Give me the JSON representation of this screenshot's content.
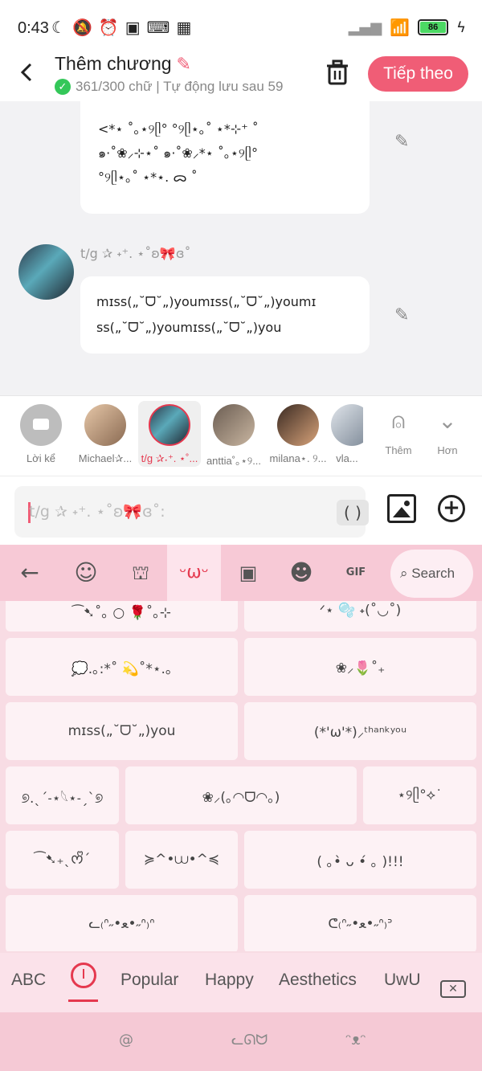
{
  "status_bar": {
    "time": "0:43",
    "battery": "86"
  },
  "header": {
    "title": "Thêm chương",
    "subtitle": "361/300 chữ | Tự động lưu sau 59",
    "next_label": "Tiếp theo"
  },
  "chat": {
    "bubble1_lines": [
      "<*⋆ ˚｡⋆୨ᥫ°   °୨ᥫ⋆｡˚ ⋆*⊹⁺ ˚",
      "๑·˚❀⸝⊹⋆˚ ๑·˚❀⸝*⋆ ˚｡⋆୨ᥫ°",
      "°୨ᥫ⋆｡˚ ⋆*⋆. ᯅ ˚"
    ],
    "sender_name": "t/g ✰ ˖⁺. ⋆˚ʚ🎀ɞ˚",
    "bubble2_lines": [
      "mɪss(„˘ᗜ˘„)youmɪss(„˘ᗜ˘„)youmɪ",
      "ss(„˘ᗜ˘„)youmɪss(„˘ᗜ˘„)you"
    ]
  },
  "characters": [
    {
      "label": "Lời kể"
    },
    {
      "label": "Michael✰..."
    },
    {
      "label": "t/g ✰˖⁺. ⋆˚..."
    },
    {
      "label": "anttia˚｡⋆୨..."
    },
    {
      "label": "milana⋆. ୨..."
    },
    {
      "label": "vla..."
    }
  ],
  "more": {
    "add_label": "Thêm",
    "more_label": "Hơn"
  },
  "input": {
    "value": "t/g ✰ ˖⁺. ⋆˚ʚ🎀ɞ˚:",
    "paren": "( )"
  },
  "keyboard": {
    "search_label": "Search",
    "cells": [
      "⁀➷˚｡ ○ 🌹˚｡⊹",
      "ᐟ⋆ 🫧 ˖(˚◡˚)",
      "💭.｡:*˚ 💫˚*⋆.｡",
      "❀⸝🌷˚₊",
      "mɪss(„˘ᗜ˘„)you",
      "(*'ω'*)⸝ᵗʰᵃⁿᵏʸᵒᵘ",
      "୭.ˎˊ˗⋆𓆩⋆˗ˏˋ୭",
      "❀⸝(｡◠ᗜ◠｡)",
      "⋆୨ᥫ°⟡˙",
      "⁀➷₊ˎᰔᩚˊ",
      "≽^•⩊•^≼",
      "( ｡•̀ ᴗ •́ ｡ )!!!",
      "ᓚ₍ᐢ˶•ﻌ•˶ᐢ₎ᐢ",
      "ᕦ₍ᐢ˶•ﻌ•˶ᐢ₎ᐣ"
    ],
    "tabs": [
      "ABC",
      "Popular",
      "Happy",
      "Aesthetics",
      "UwU"
    ],
    "active_tab": "recent",
    "accent": "#e5394f"
  }
}
